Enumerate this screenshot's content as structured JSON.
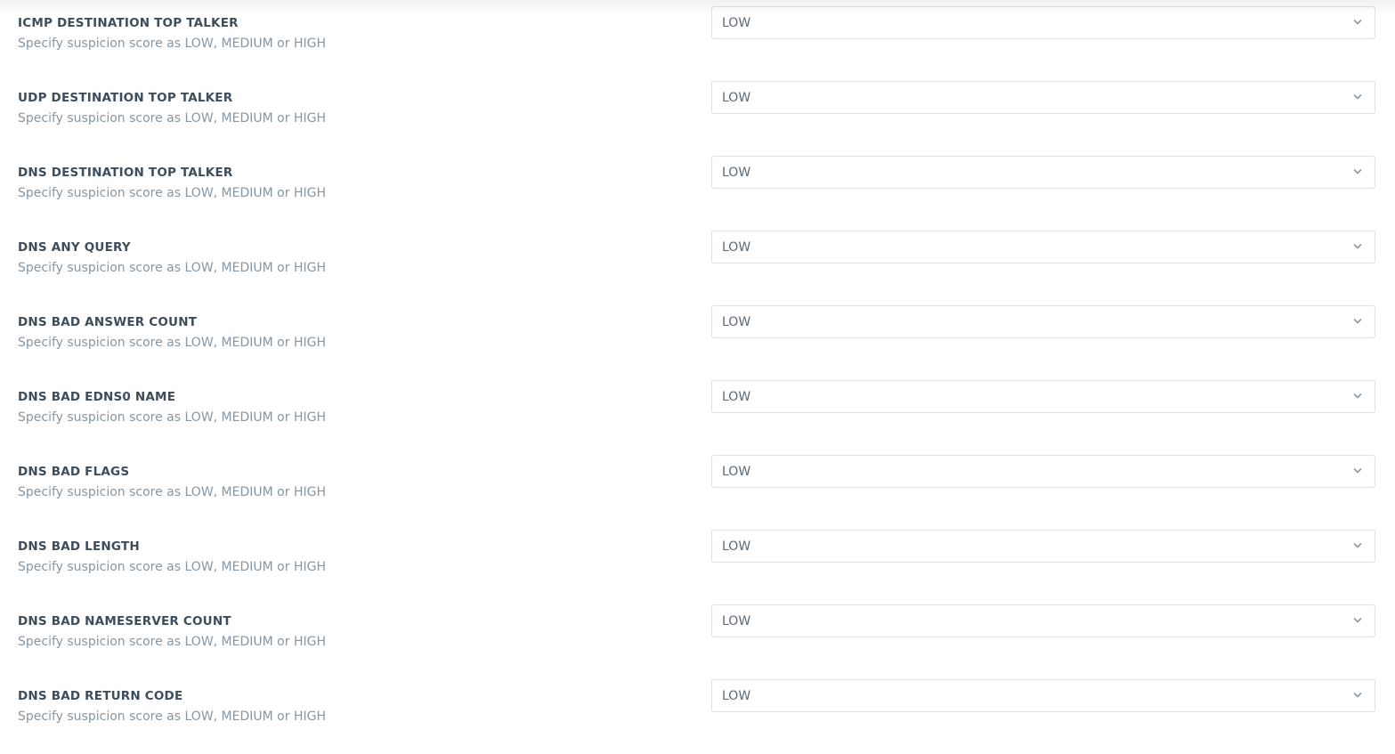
{
  "settings": {
    "items": [
      {
        "title": "ICMP DESTINATION TOP TALKER",
        "description": "Specify suspicion score as LOW, MEDIUM or HIGH",
        "value": "LOW"
      },
      {
        "title": "UDP DESTINATION TOP TALKER",
        "description": "Specify suspicion score as LOW, MEDIUM or HIGH",
        "value": "LOW"
      },
      {
        "title": "DNS DESTINATION TOP TALKER",
        "description": "Specify suspicion score as LOW, MEDIUM or HIGH",
        "value": "LOW"
      },
      {
        "title": "DNS ANY QUERY",
        "description": "Specify suspicion score as LOW, MEDIUM or HIGH",
        "value": "LOW"
      },
      {
        "title": "DNS BAD ANSWER COUNT",
        "description": "Specify suspicion score as LOW, MEDIUM or HIGH",
        "value": "LOW"
      },
      {
        "title": "DNS BAD EDNS0 NAME",
        "description": "Specify suspicion score as LOW, MEDIUM or HIGH",
        "value": "LOW"
      },
      {
        "title": "DNS BAD FLAGS",
        "description": "Specify suspicion score as LOW, MEDIUM or HIGH",
        "value": "LOW"
      },
      {
        "title": "DNS BAD LENGTH",
        "description": "Specify suspicion score as LOW, MEDIUM or HIGH",
        "value": "LOW"
      },
      {
        "title": "DNS BAD NAMESERVER COUNT",
        "description": "Specify suspicion score as LOW, MEDIUM or HIGH",
        "value": "LOW"
      },
      {
        "title": "DNS BAD RETURN CODE",
        "description": "Specify suspicion score as LOW, MEDIUM or HIGH",
        "value": "LOW"
      }
    ]
  },
  "icons": {
    "select_arrow": "chevron-down-icon"
  },
  "colors": {
    "title_text": "#3d4d5c",
    "description_text": "#8796a3",
    "select_border": "#dbe1e7",
    "select_text": "#5a6a78",
    "chevron": "#8a96a1"
  }
}
